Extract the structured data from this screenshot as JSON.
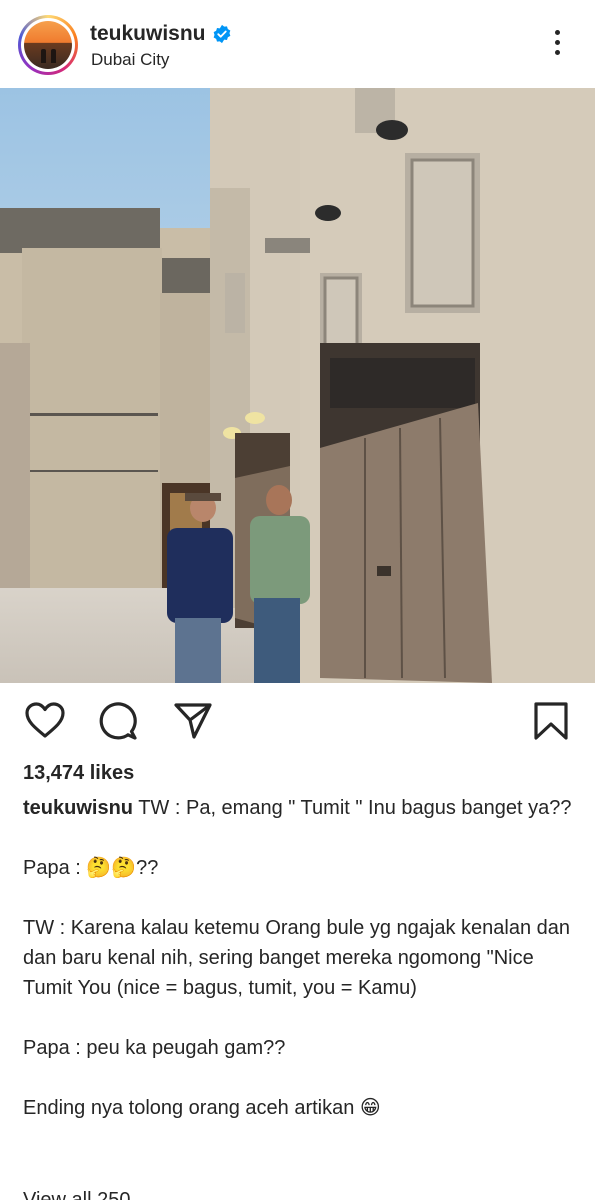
{
  "post": {
    "username": "teukuwisnu",
    "location": "Dubai City",
    "verified_icon": "verified-badge-icon",
    "more_icon": "more-vertical-icon",
    "likes": "13,474 likes",
    "caption_user": "teukuwisnu",
    "caption_lines": [
      " TW : Pa, emang \" Tumit \" Inu bagus banget ya??",
      "Papa : 🤔🤔??",
      "TW : Karena kalau ketemu Orang bule yg ngajak kenalan dan dan baru kenal nih, sering banget mereka ngomong \"Nice Tumit You (nice = bagus, tumit, you = Kamu)",
      "Papa : peu ka peugah gam??",
      "Ending nya tolong orang aceh artikan 😁"
    ],
    "views_partial": "View all 250"
  },
  "actions": {
    "like_icon": "heart-icon",
    "comment_icon": "comment-icon",
    "share_icon": "send-icon",
    "save_icon": "bookmark-icon"
  },
  "colors": {
    "text": "#262626",
    "verified": "#0095f6",
    "sky": "#b9d6ea",
    "wall": "#cfc6b6"
  }
}
